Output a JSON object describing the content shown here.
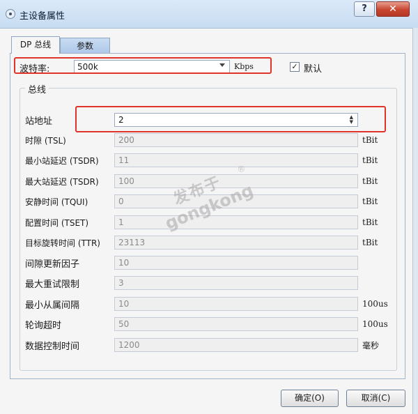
{
  "window": {
    "title": "主设备属性",
    "help_label": "?",
    "close_label": "✕"
  },
  "tabs": [
    {
      "label": "DP 总线",
      "active": true
    },
    {
      "label": "参数",
      "active": false
    }
  ],
  "baud": {
    "label": "波特率:",
    "value": "500k",
    "unit": "Kbps"
  },
  "default_checkbox": {
    "label": "默认",
    "checked": true,
    "mark": "✓"
  },
  "group": {
    "legend": "总线"
  },
  "rows": [
    {
      "label": "站地址",
      "value": "2",
      "unit": "",
      "editable": true
    },
    {
      "label": "时隙 (TSL)",
      "value": "200",
      "unit": "tBit",
      "editable": false
    },
    {
      "label": "最小站延迟 (TSDR)",
      "value": "11",
      "unit": "tBit",
      "editable": false
    },
    {
      "label": "最大站延迟 (TSDR)",
      "value": "100",
      "unit": "tBit",
      "editable": false
    },
    {
      "label": "安静时间 (TQUI)",
      "value": "0",
      "unit": "tBit",
      "editable": false
    },
    {
      "label": "配置时间 (TSET)",
      "value": "1",
      "unit": "tBit",
      "editable": false
    },
    {
      "label": "目标旋转时间 (TTR)",
      "value": "23113",
      "unit": "tBit",
      "editable": false
    },
    {
      "label": "间隙更新因子",
      "value": "10",
      "unit": "",
      "editable": false
    },
    {
      "label": "最大重试限制",
      "value": "3",
      "unit": "",
      "editable": false
    },
    {
      "label": "最小从属间隔",
      "value": "10",
      "unit": "100us",
      "editable": false
    },
    {
      "label": "轮询超时",
      "value": "50",
      "unit": "100us",
      "editable": false
    },
    {
      "label": "数据控制时间",
      "value": "1200",
      "unit": "毫秒",
      "editable": false
    }
  ],
  "buttons": {
    "ok": "确定(O)",
    "cancel": "取消(C)"
  },
  "watermark": {
    "cn": "发布于",
    "en": "gongkong",
    "reg": "®"
  },
  "colors": {
    "highlight": "#e0332a",
    "title_bar": "#c7dcf2",
    "close": "#c8452f"
  }
}
